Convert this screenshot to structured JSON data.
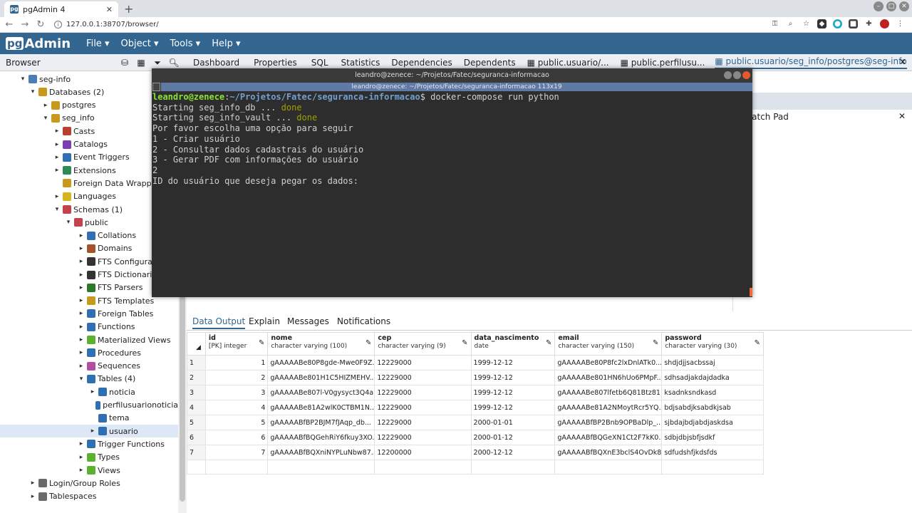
{
  "browser_tab": {
    "title": "pgAdmin 4",
    "favicon": "pg"
  },
  "address": {
    "url": "127.0.0.1:38707/browser/"
  },
  "navbar": {
    "logo_pg": "pg",
    "logo_text": "Admin",
    "menus": [
      "File",
      "Object",
      "Tools",
      "Help"
    ]
  },
  "browser_panel": {
    "title": "Browser"
  },
  "tree": [
    {
      "label": "seg-info",
      "icon": "server-icon",
      "depth": 0
    },
    {
      "label": "Databases (2)",
      "icon": "databases-icon",
      "depth": 1
    },
    {
      "label": "postgres",
      "icon": "database-icon",
      "depth": 2
    },
    {
      "label": "seg_info",
      "icon": "database-icon",
      "depth": 2
    },
    {
      "label": "Casts",
      "icon": "casts-icon",
      "depth": 3
    },
    {
      "label": "Catalogs",
      "icon": "catalogs-icon",
      "depth": 3
    },
    {
      "label": "Event Triggers",
      "icon": "event-triggers-icon",
      "depth": 3
    },
    {
      "label": "Extensions",
      "icon": "extensions-icon",
      "depth": 3
    },
    {
      "label": "Foreign Data Wrappers",
      "icon": "fdw-icon",
      "depth": 3
    },
    {
      "label": "Languages",
      "icon": "languages-icon",
      "depth": 3
    },
    {
      "label": "Schemas (1)",
      "icon": "schemas-icon",
      "depth": 3
    },
    {
      "label": "public",
      "icon": "schema-icon",
      "depth": 4
    },
    {
      "label": "Collations",
      "icon": "collations-icon",
      "depth": 5
    },
    {
      "label": "Domains",
      "icon": "domains-icon",
      "depth": 5
    },
    {
      "label": "FTS Configurations",
      "icon": "fts-config-icon",
      "depth": 5
    },
    {
      "label": "FTS Dictionaries",
      "icon": "fts-dict-icon",
      "depth": 5
    },
    {
      "label": "FTS Parsers",
      "icon": "fts-parser-icon",
      "depth": 5
    },
    {
      "label": "FTS Templates",
      "icon": "fts-template-icon",
      "depth": 5
    },
    {
      "label": "Foreign Tables",
      "icon": "foreign-tables-icon",
      "depth": 5
    },
    {
      "label": "Functions",
      "icon": "functions-icon",
      "depth": 5
    },
    {
      "label": "Materialized Views",
      "icon": "mviews-icon",
      "depth": 5
    },
    {
      "label": "Procedures",
      "icon": "procedures-icon",
      "depth": 5
    },
    {
      "label": "Sequences",
      "icon": "sequences-icon",
      "depth": 5
    },
    {
      "label": "Tables (4)",
      "icon": "tables-icon",
      "depth": 5
    },
    {
      "label": "noticia",
      "icon": "table-icon",
      "depth": 6
    },
    {
      "label": "perfilusuarionoticia",
      "icon": "table-icon",
      "depth": 6
    },
    {
      "label": "tema",
      "icon": "table-icon",
      "depth": 6
    },
    {
      "label": "usuario",
      "icon": "table-icon",
      "depth": 6
    },
    {
      "label": "Trigger Functions",
      "icon": "trigger-functions-icon",
      "depth": 5
    },
    {
      "label": "Types",
      "icon": "types-icon",
      "depth": 5
    },
    {
      "label": "Views",
      "icon": "views-icon",
      "depth": 5
    },
    {
      "label": "Login/Group Roles",
      "icon": "roles-icon",
      "depth": 1
    },
    {
      "label": "Tablespaces",
      "icon": "tablespaces-icon",
      "depth": 1
    }
  ],
  "tabs": [
    "Dashboard",
    "Properties",
    "SQL",
    "Statistics",
    "Dependencies",
    "Dependents",
    "public.usuario/...",
    "public.perfilusu...",
    "public.usuario/seg_info/postgres@seg-info"
  ],
  "scratch_pad": {
    "title": "Scratch Pad"
  },
  "output_tabs": [
    "Data Output",
    "Explain",
    "Messages",
    "Notifications"
  ],
  "grid": {
    "columns": [
      {
        "name": "id",
        "type": "[PK] integer"
      },
      {
        "name": "nome",
        "type": "character varying (100)"
      },
      {
        "name": "cep",
        "type": "character varying (9)"
      },
      {
        "name": "data_nascimento",
        "type": "date"
      },
      {
        "name": "email",
        "type": "character varying (150)"
      },
      {
        "name": "password",
        "type": "character varying (30)"
      }
    ],
    "rows": [
      [
        "1",
        "1",
        "gAAAAABe80P8gde-Mwe0F9Z...",
        "12229000",
        "1999-12-12",
        "gAAAAABe80P8fc2lxDnlATk0...",
        "shdjdjjsacbssaj"
      ],
      [
        "2",
        "2",
        "gAAAAABe801H1C5HIZMEHV...",
        "12229000",
        "1999-12-12",
        "gAAAAABe801HN6hUo6PMpF...",
        "sdhsadjakdajdadka"
      ],
      [
        "3",
        "3",
        "gAAAAABe807l-V0gysyct3Q4a...",
        "12229000",
        "1999-12-12",
        "gAAAAABe807lfetb6Q81Btz81...",
        "ksadnksndkasd"
      ],
      [
        "4",
        "4",
        "gAAAAABe81A2wlK0CTBM1N...",
        "12229000",
        "1999-12-12",
        "gAAAAABe81A2NMoytRcr5YQ...",
        "bdjsabdjksabdkjsab"
      ],
      [
        "5",
        "5",
        "gAAAAABfBP2BJM7fJAqp_db...",
        "12229000",
        "2000-01-01",
        "gAAAAABfBP2Bnb9OPBaDlp_...",
        "sjbdajbdjabdjaskdsa"
      ],
      [
        "6",
        "6",
        "gAAAAABfBQGehRiY6fkuy3XO...",
        "12229000",
        "2000-01-12",
        "gAAAAABfBQGeXN1Ct2F7kK0...",
        "sdbjdbjsbfjsdkf"
      ],
      [
        "7",
        "7",
        "gAAAAABfBQXniNYPLuNbw87...",
        "12200000",
        "2000-12-12",
        "gAAAAABfBQXnE3bclS4OvDk8...",
        "sdfudshfjkdsfds"
      ]
    ]
  },
  "terminal": {
    "title": "leandro@zenece: ~/Projetos/Fatec/seguranca-informacao",
    "subtitle": "leandro@zenece: ~/Projetos/Fatec/seguranca-informacao 113x19",
    "prompt_user": "leandro@zenece",
    "prompt_sep": ":",
    "prompt_path": "~/Projetos/Fatec/seguranca-informacao",
    "prompt_end": "$ ",
    "command": "docker-compose run python",
    "start1": "Starting seg_info_db ... ",
    "start2": "Starting seg_info_vault ... ",
    "done": "done",
    "lines": [
      "Por favor escolha uma opção para seguir",
      "1 - Criar usuário",
      "2 - Consultar dados cadastrais do usuário",
      "3 - Gerar PDF com informações do usuário",
      "2",
      "ID do usuário que deseja pegar os dados:"
    ]
  },
  "colors": {
    "pgadmin_blue": "#326690",
    "terminal_bg": "#2d2d2d",
    "prompt_green": "#8ae234",
    "prompt_blue": "#729fcf"
  }
}
